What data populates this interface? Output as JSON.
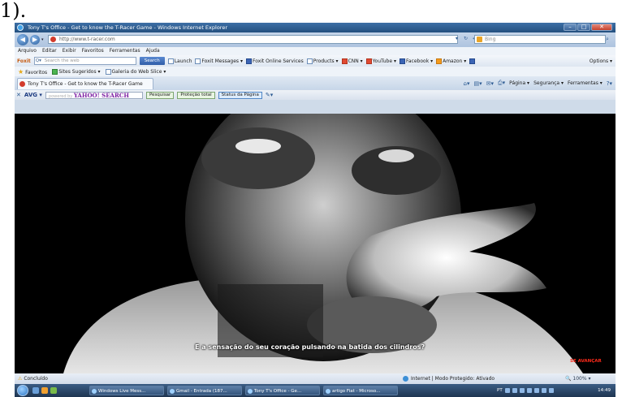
{
  "caption_marker": "1).",
  "window": {
    "title": "Tony T's Office - Get to know the T-Racer Game - Windows Internet Explorer",
    "minimize": "–",
    "maximize": "□",
    "close": "✕"
  },
  "nav": {
    "back": "◀",
    "forward": "▶",
    "address": "http://www.t-racer.com",
    "search_placeholder": "Bing"
  },
  "menu": [
    "Arquivo",
    "Editar",
    "Exibir",
    "Favoritos",
    "Ferramentas",
    "Ajuda"
  ],
  "foxit_bar": {
    "logo": "Foxit",
    "search_placeholder": "Search the web",
    "search_button": "Search",
    "items": [
      "Launch",
      "Foxit Messages ▾",
      "Foxit Online Services",
      "Products ▾",
      "CNN ▾",
      "YouTube ▾",
      "Facebook ▾",
      "Amazon ▾"
    ],
    "options": "Options ▾"
  },
  "favorites_bar": {
    "favorites": "Favoritos",
    "items": [
      "Sites Sugeridos ▾",
      "Galeria do Web Slice ▾"
    ]
  },
  "tab": {
    "title": "Tony T's Office - Get to know the T-Racer Game"
  },
  "command_bar": [
    "Página ▾",
    "Segurança ▾",
    "Ferramentas ▾"
  ],
  "avg_bar": {
    "logo": "AVG ▾",
    "yahoo_placeholder": "powered by",
    "yahoo_logo": "YAHOO! SEARCH",
    "search_button": "Pesquisar",
    "protection": "Proteção total",
    "status": "Status da Página"
  },
  "video": {
    "subtitle": "E a sensação do seu coração pulsando na batida dos cilindros?",
    "skip": "SE AVANÇAR"
  },
  "status_bar": {
    "left": "Concluído",
    "zone": "Internet | Modo Protegido: Ativado",
    "zoom": "100% ▾"
  },
  "taskbar": {
    "items": [
      "Windows Live Mess...",
      "Gmail - Entrada (187...",
      "Tony T's Office - Ge...",
      "artigo Fiat - Microso..."
    ],
    "lang": "PT",
    "clock": "14:49"
  },
  "colors": {
    "chrome": "#cfdbe9",
    "title_bar": "#2f5f95",
    "video_bg": "#000000",
    "skip_link": "#ff2a1a"
  }
}
